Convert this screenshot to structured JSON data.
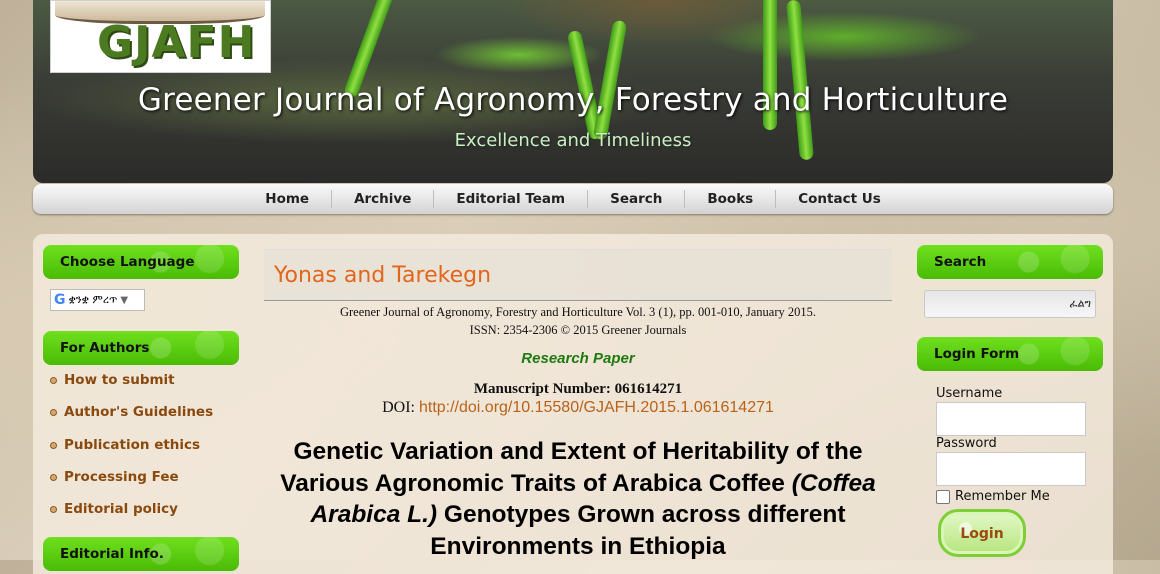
{
  "header": {
    "logo_text": "GJAFH",
    "site_title": "Greener Journal of Agronomy, Forestry and Horticulture",
    "slogan": "Excellence and Timeliness"
  },
  "nav": [
    "Home",
    "Archive",
    "Editorial Team",
    "Search",
    "Books",
    "Contact Us"
  ],
  "left": {
    "language": {
      "heading": "Choose Language",
      "selected": "ቋንቋ ምረጥ"
    },
    "authors": {
      "heading": "For Authors",
      "items": [
        "How to submit",
        "Author's Guidelines",
        "Publication ethics",
        "Processing Fee",
        "Editorial policy"
      ]
    },
    "editorial": {
      "heading": "Editorial Info."
    }
  },
  "article": {
    "authors": "Yonas and Tarekegn",
    "citation_line1": "Greener Journal of Agronomy, Forestry and Horticulture Vol. 3 (1), pp. 001-010, January 2015.",
    "citation_line2": "ISSN: 2354-2306 © 2015 Greener Journals",
    "paper_type": "Research Paper",
    "manuscript": "Manuscript Number: 061614271",
    "doi_label": "DOI:",
    "doi_link": "http://doi.org/10.15580/GJAFH.2015.1.061614271",
    "title_part1": "Genetic Variation and Extent of Heritability of the Various Agronomic Traits of Arabica Coffee",
    "title_italic": "(Coffea Arabica L.)",
    "title_part2": "Genotypes Grown across different Environments in Ethiopia"
  },
  "right": {
    "search": {
      "heading": "Search",
      "button_text": "ፈልግ"
    },
    "login": {
      "heading": "Login Form",
      "username_label": "Username",
      "password_label": "Password",
      "remember_label": "Remember Me",
      "button": "Login"
    }
  }
}
